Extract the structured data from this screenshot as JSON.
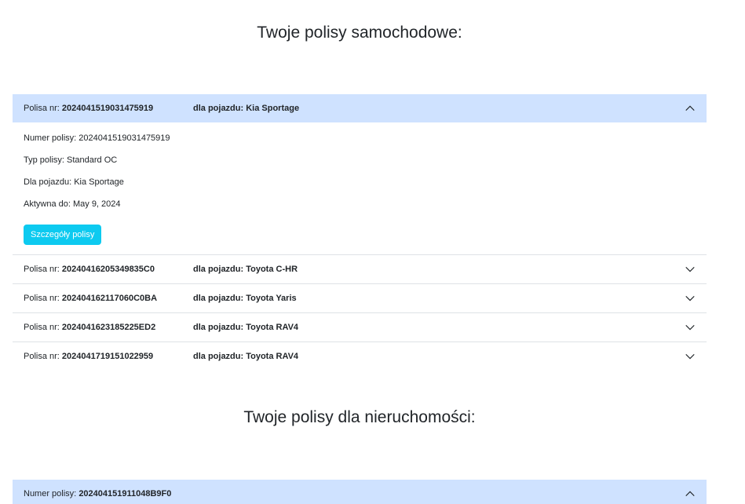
{
  "auto_section": {
    "title": "Twoje polisy samochodowe:",
    "open_policy": {
      "nr_label": "Polisa nr:",
      "nr_value": "2024041519031475919",
      "vehicle_header": "dla pojazdu: Kia Sportage",
      "details": [
        "Numer polisy: 2024041519031475919",
        "Typ polisy: Standard OC",
        "Dla pojazdu: Kia Sportage",
        "Aktywna do: May 9, 2024"
      ],
      "button_label": "Szczegóły polisy"
    },
    "collapsed_policies": [
      {
        "nr_label": "Polisa nr:",
        "nr_value": "2024041620534983​5C0",
        "vehicle_header": "dla pojazdu: Toyota C-HR"
      },
      {
        "nr_label": "Polisa nr:",
        "nr_value": "202404162117060C0BA",
        "vehicle_header": "dla pojazdu: Toyota Yaris"
      },
      {
        "nr_label": "Polisa nr:",
        "nr_value": "2024041623185225ED2",
        "vehicle_header": "dla pojazdu: Toyota RAV4"
      },
      {
        "nr_label": "Polisa nr:",
        "nr_value": "2024041719151022959",
        "vehicle_header": "dla pojazdu: Toyota RAV4"
      }
    ]
  },
  "property_section": {
    "title": "Twoje polisy dla nieruchomości:",
    "open_policy": {
      "nr_label": "Numer polisy:",
      "nr_value": "202404151911048B9F0"
    }
  },
  "icons": {
    "expanded": "chevron-up-icon",
    "collapsed": "chevron-down-icon"
  },
  "colors": {
    "open_header_bg": "#cfe2ff",
    "button_bg": "#0dcaf0",
    "divider": "#dee2e6"
  }
}
